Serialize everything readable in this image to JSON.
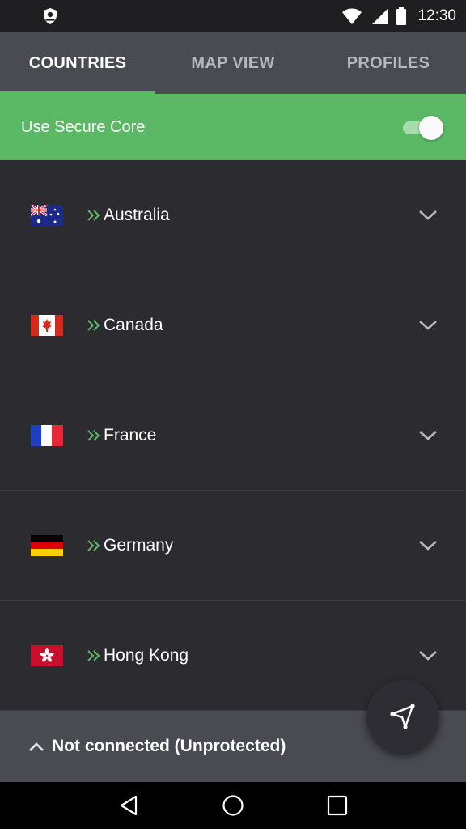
{
  "status_bar": {
    "time": "12:30",
    "icons": [
      "app-badge-icon",
      "wifi-icon",
      "cellular-icon",
      "battery-icon"
    ]
  },
  "tabs": [
    {
      "label": "COUNTRIES",
      "active": true
    },
    {
      "label": "MAP VIEW",
      "active": false
    },
    {
      "label": "PROFILES",
      "active": false
    }
  ],
  "secure_core": {
    "label": "Use Secure Core",
    "enabled": true
  },
  "countries": [
    {
      "name": "Australia",
      "flag": "australia-flag-icon"
    },
    {
      "name": "Canada",
      "flag": "canada-flag-icon"
    },
    {
      "name": "France",
      "flag": "france-flag-icon"
    },
    {
      "name": "Germany",
      "flag": "germany-flag-icon"
    },
    {
      "name": "Hong Kong",
      "flag": "hong-kong-flag-icon"
    }
  ],
  "connection": {
    "status": "Not connected (Unprotected)"
  },
  "colors": {
    "accent": "#5bb864",
    "background": "#2b2b30",
    "tab_bar": "#4a4a52",
    "status_bar": "#1f1f22"
  },
  "fab": {
    "icon": "connect-send-icon"
  },
  "nav_bar": {
    "icons": [
      "back-icon",
      "home-icon",
      "recents-icon"
    ]
  }
}
